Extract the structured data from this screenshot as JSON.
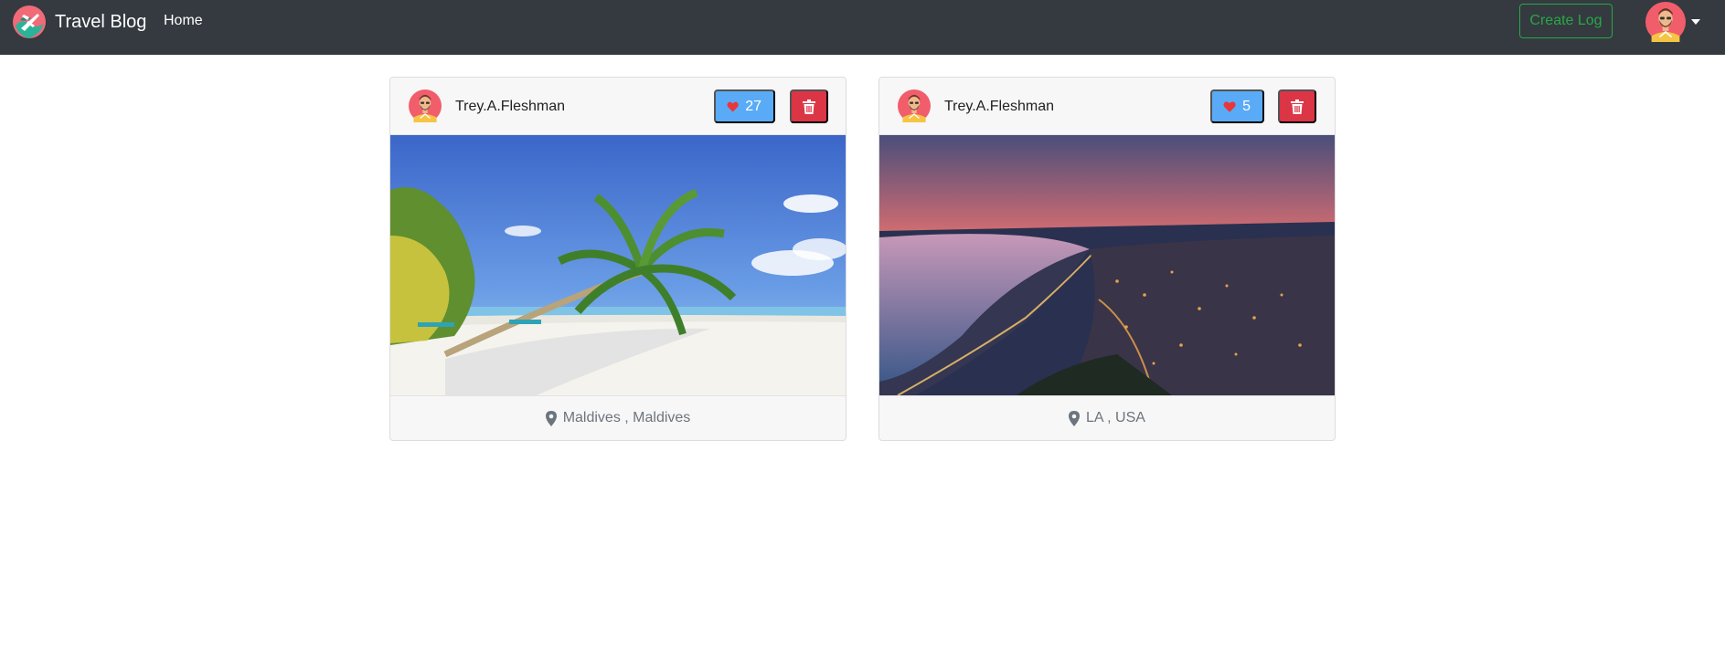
{
  "navbar": {
    "brand": "Travel Blog",
    "home_link": "Home",
    "create_log_label": "Create Log",
    "logo_icon": "plane-globe-logo",
    "user_icon": "user-avatar",
    "colors": {
      "background": "#343a40",
      "create_log": "#28a745"
    }
  },
  "posts": [
    {
      "author": "Trey.A.Fleshman",
      "likes": "27",
      "location": "Maldives , Maldives",
      "image": "tropical-beach-palm-trees"
    },
    {
      "author": "Trey.A.Fleshman",
      "likes": "5",
      "location": "LA , USA",
      "image": "coastal-city-sunset"
    }
  ],
  "colors": {
    "like": "#5aabf7",
    "heart": "#e9363b",
    "delete": "#dc3545"
  }
}
